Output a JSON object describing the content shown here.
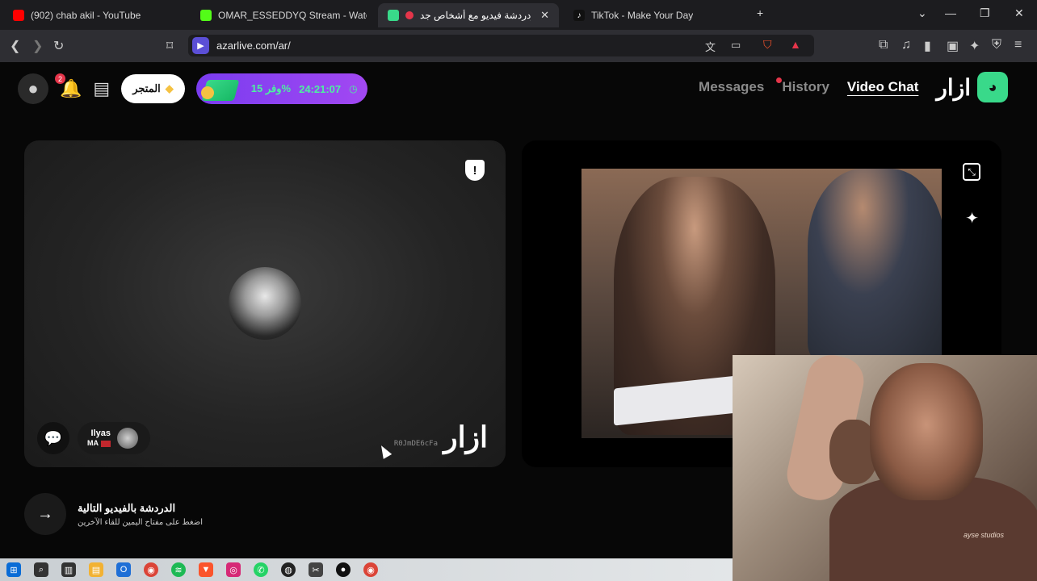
{
  "browser": {
    "tabs": [
      {
        "label": "(902) chab akil - YouTube",
        "color": "#ff0000",
        "active": false
      },
      {
        "label": "OMAR_ESSEDDYQ Stream - Watch Li",
        "color": "#53fc18",
        "active": false
      },
      {
        "label": "أزاردردشة فيديو مع أشخاص جد",
        "color": "#39d98a",
        "active": true
      },
      {
        "label": "TikTok - Make Your Day",
        "color": "#111111",
        "active": false
      }
    ],
    "url": "azarlive.com/ar/"
  },
  "header": {
    "store_label": "المتجر",
    "notification_count": "2",
    "promo": {
      "discount": "وفر 15%",
      "timer": "24:21:07"
    },
    "nav": {
      "messages": "Messages",
      "history": "History",
      "video_chat": "Video Chat"
    },
    "brand": "ازار"
  },
  "peer": {
    "name": "Ilyas",
    "country": "MA",
    "session_id": "R0JmDE6cFa",
    "watermark": "ازار"
  },
  "next": {
    "title": "الدردشة بالفيديو التالية",
    "hint": "اضغط على مفتاح اليمين للقاء الآخرين"
  },
  "webcam_overlay": {
    "shirt_text": "ayse studios"
  },
  "colors": {
    "accent": "#39d98a",
    "promo": "#8f42f1",
    "badge": "#e5354a"
  }
}
